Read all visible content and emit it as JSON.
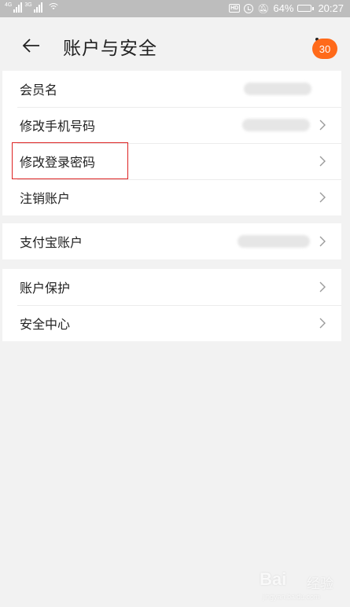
{
  "status_bar": {
    "signal1_tag": "4G",
    "signal2_tag": "3G",
    "battery_percent": "64%",
    "battery_level": 0.64,
    "time": "20:27",
    "hd_label": "HD"
  },
  "header": {
    "title": "账户与安全",
    "badge_count": "30"
  },
  "groups": [
    {
      "items": [
        {
          "label": "会员名",
          "has_value": true,
          "has_chevron": false
        },
        {
          "label": "修改手机号码",
          "has_value": true,
          "has_chevron": true
        },
        {
          "label": "修改登录密码",
          "has_value": false,
          "has_chevron": true,
          "highlighted": true
        },
        {
          "label": "注销账户",
          "has_value": false,
          "has_chevron": true
        }
      ]
    },
    {
      "items": [
        {
          "label": "支付宝账户",
          "has_value": true,
          "has_chevron": true
        }
      ]
    },
    {
      "items": [
        {
          "label": "账户保护",
          "has_value": false,
          "has_chevron": true
        },
        {
          "label": "安全中心",
          "has_value": false,
          "has_chevron": true
        }
      ]
    }
  ],
  "colors": {
    "background": "#f2f2f2",
    "badge": "#ff6a1a",
    "highlight_border": "#dd2222"
  },
  "watermark": {
    "logo_text": "Bai",
    "sub_text": "经验",
    "url": "jingyan.baidu.com"
  }
}
